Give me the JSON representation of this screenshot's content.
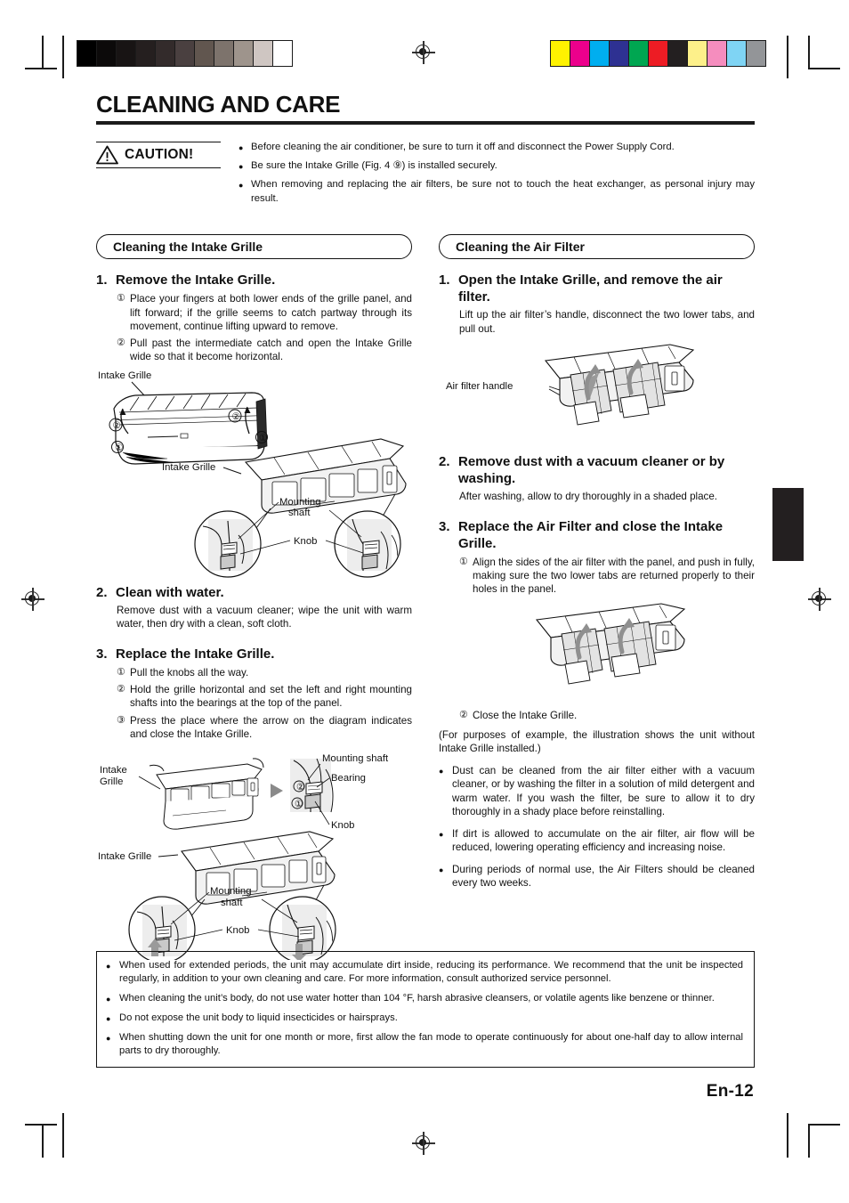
{
  "document": {
    "title": "CLEANING AND CARE",
    "page_number": "En-12"
  },
  "caution": {
    "label": "CAUTION!",
    "icon": "warning-triangle-icon",
    "items": [
      "Before cleaning the air conditioner, be sure to turn it off and disconnect the Power Supply Cord.",
      "Be sure the Intake Grille (Fig. 4 ⑨) is installed securely.",
      "When removing and replacing the air filters, be sure not to touch the heat exchanger, as personal injury may result."
    ]
  },
  "left_column": {
    "section_title": "Cleaning the Intake Grille",
    "step1": {
      "num": "1.",
      "title": "Remove the Intake Grille.",
      "subs": [
        {
          "mark": "①",
          "text": "Place your fingers at both lower ends of the grille panel, and lift forward; if the grille seems to catch partway through its movement, continue lifting upward to remove."
        },
        {
          "mark": "②",
          "text": "Pull past the intermediate catch and open the Intake Grille wide so that it become horizontal."
        }
      ]
    },
    "figure1": {
      "labels": {
        "intake_grille_top": "Intake Grille",
        "intake_grille_lower": "Intake Grille",
        "mounting_shaft": "Mounting shaft",
        "knob": "Knob",
        "callout_1": "①",
        "callout_2": "②"
      }
    },
    "step2": {
      "num": "2.",
      "title": "Clean with water.",
      "body": "Remove dust with a vacuum cleaner; wipe the unit with warm water, then dry with a clean, soft cloth."
    },
    "step3": {
      "num": "3.",
      "title": "Replace the Intake Grille.",
      "subs": [
        {
          "mark": "①",
          "text": "Pull the knobs all the way."
        },
        {
          "mark": "②",
          "text": "Hold the grille horizontal and set the left and right mounting shafts into the bearings at the top of the panel."
        },
        {
          "mark": "③",
          "text": "Press the place where the arrow on the diagram indicates and close the Intake Grille."
        }
      ]
    },
    "figure2": {
      "labels": {
        "intake_grille": "Intake Grille",
        "mounting_shaft": "Mounting shaft",
        "bearing": "Bearing",
        "knob": "Knob",
        "callout_1": "①",
        "callout_2": "②"
      }
    },
    "figure3": {
      "labels": {
        "intake_grille": "Intake Grille",
        "mounting_shaft": "Mounting shaft",
        "knob": "Knob"
      }
    }
  },
  "right_column": {
    "section_title": "Cleaning the Air Filter",
    "step1": {
      "num": "1.",
      "title": "Open the Intake Grille, and remove the air filter.",
      "body": "Lift up the air filter’s handle, disconnect the two lower tabs, and pull out."
    },
    "figure1": {
      "labels": {
        "air_filter_handle": "Air filter handle"
      }
    },
    "step2": {
      "num": "2.",
      "title": "Remove dust with a vacuum cleaner or by washing.",
      "body": "After washing, allow to dry thoroughly in a shaded place."
    },
    "step3": {
      "num": "3.",
      "title": "Replace the Air Filter and close the Intake Grille.",
      "subs": [
        {
          "mark": "①",
          "text": "Align the sides of the air filter with the panel, and push in fully, making sure the two lower tabs are returned properly to their holes in the panel."
        }
      ]
    },
    "after_figure_sub": {
      "mark": "②",
      "text": "Close the Intake Grille."
    },
    "note": "(For purposes of example, the illustration shows the unit without Intake Grille installed.)",
    "bullets": [
      "Dust can be cleaned from the air filter either with a vacuum cleaner, or by washing the filter in a solution of mild detergent and warm water. If you wash the filter, be sure to allow it to dry thoroughly in a shady place before reinstalling.",
      "If dirt is allowed to accumulate on the air filter, air flow will be reduced, lowering operating efficiency and increasing noise.",
      "During periods of normal use, the Air Filters should be cleaned every two weeks."
    ]
  },
  "bottom_note": {
    "items": [
      "When used for extended periods, the unit may accumulate dirt inside, reducing its performance. We recommend that the unit be inspected regularly, in addition to your own cleaning and care. For more information, consult authorized service personnel.",
      "When cleaning the unit’s body, do not use water hotter than 104 °F, harsh abrasive cleansers, or volatile agents like benzene or thinner.",
      "Do not expose the unit body to liquid insecticides or hairsprays.",
      "When shutting down the unit for one month or more, first allow the fan mode to operate continuously for about one-half day to allow internal parts to dry thoroughly."
    ]
  },
  "print_marks": {
    "grayscale_wedge": [
      "#000000",
      "#0c0a0a",
      "#181414",
      "#251f1f",
      "#332b2b",
      "#4a4040",
      "#61564f",
      "#7d736c",
      "#9e948c",
      "#cfc6c2",
      "#ffffff"
    ],
    "color_bar": [
      "#fff200",
      "#ec008c",
      "#00aeef",
      "#2e3192",
      "#00a651",
      "#ed1c24",
      "#231f20",
      "#fdf08a",
      "#f58dbe",
      "#7fd4f4",
      "#939598"
    ]
  }
}
